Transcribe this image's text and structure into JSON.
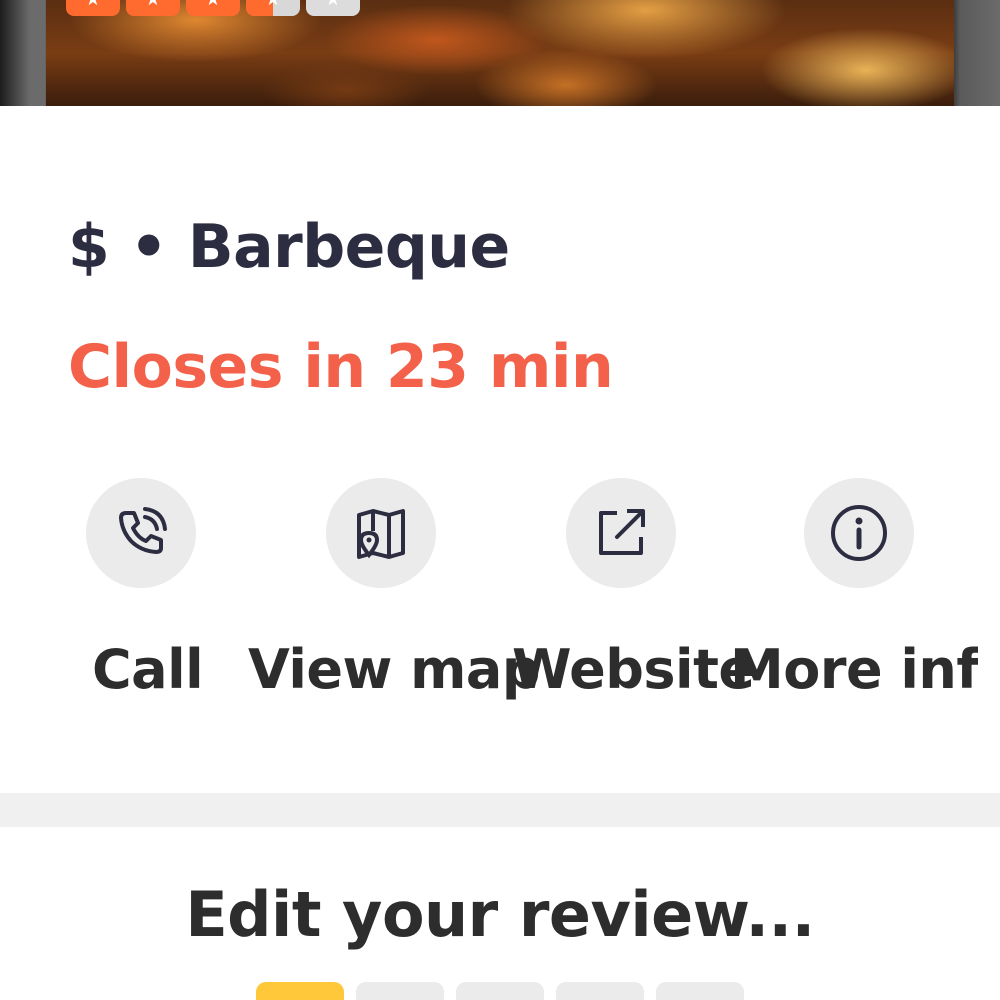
{
  "business": {
    "price": "$",
    "separator": "•",
    "category": "Barbeque",
    "hours_status": "Closes in 23 min",
    "hero_rating": 3.5
  },
  "actions": [
    {
      "id": "call",
      "label": "Call",
      "icon": "phone-icon"
    },
    {
      "id": "map",
      "label": "View map",
      "icon": "map-icon"
    },
    {
      "id": "website",
      "label": "Website",
      "icon": "external-link-icon"
    },
    {
      "id": "more",
      "label": "More info",
      "icon": "info-icon"
    }
  ],
  "review": {
    "title": "Edit your review...",
    "selected_stars": 1,
    "max_stars": 5
  },
  "colors": {
    "title_text": "#2d2d42",
    "closing_red": "#f4614a",
    "star_orange": "#ff6a2e",
    "rate_yellow": "#ffc83a",
    "action_bg": "#ebebeb"
  }
}
